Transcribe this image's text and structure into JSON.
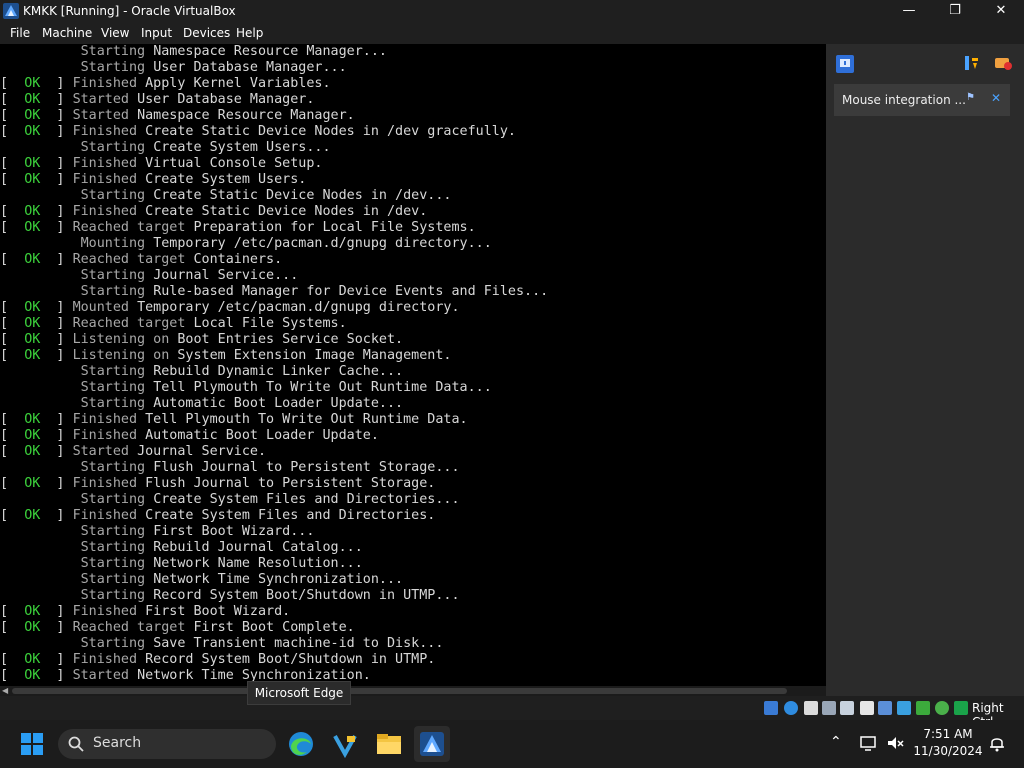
{
  "window": {
    "title": "KMKK [Running] - Oracle VirtualBox"
  },
  "menu": [
    "File",
    "Machine",
    "View",
    "Input",
    "Devices",
    "Help"
  ],
  "console_lines": [
    {
      "ok": false,
      "verb": "Starting",
      "rest": "Namespace Resource Manager..."
    },
    {
      "ok": false,
      "verb": "Starting",
      "rest": "User Database Manager..."
    },
    {
      "ok": true,
      "verb": "Finished",
      "rest": "Apply Kernel Variables."
    },
    {
      "ok": true,
      "verb": "Started",
      "rest": "User Database Manager."
    },
    {
      "ok": true,
      "verb": "Started",
      "rest": "Namespace Resource Manager."
    },
    {
      "ok": true,
      "verb": "Finished",
      "rest": "Create Static Device Nodes in /dev gracefully."
    },
    {
      "ok": false,
      "verb": "Starting",
      "rest": "Create System Users..."
    },
    {
      "ok": true,
      "verb": "Finished",
      "rest": "Virtual Console Setup."
    },
    {
      "ok": true,
      "verb": "Finished",
      "rest": "Create System Users."
    },
    {
      "ok": false,
      "verb": "Starting",
      "rest": "Create Static Device Nodes in /dev..."
    },
    {
      "ok": true,
      "verb": "Finished",
      "rest": "Create Static Device Nodes in /dev."
    },
    {
      "ok": true,
      "verb": "Reached target",
      "rest": "Preparation for Local File Systems."
    },
    {
      "ok": false,
      "verb": "Mounting",
      "rest": "Temporary /etc/pacman.d/gnupg directory..."
    },
    {
      "ok": true,
      "verb": "Reached target",
      "rest": "Containers."
    },
    {
      "ok": false,
      "verb": "Starting",
      "rest": "Journal Service..."
    },
    {
      "ok": false,
      "verb": "Starting",
      "rest": "Rule-based Manager for Device Events and Files..."
    },
    {
      "ok": true,
      "verb": "Mounted",
      "rest": "Temporary /etc/pacman.d/gnupg directory."
    },
    {
      "ok": true,
      "verb": "Reached target",
      "rest": "Local File Systems."
    },
    {
      "ok": true,
      "verb": "Listening on",
      "rest": "Boot Entries Service Socket."
    },
    {
      "ok": true,
      "verb": "Listening on",
      "rest": "System Extension Image Management."
    },
    {
      "ok": false,
      "verb": "Starting",
      "rest": "Rebuild Dynamic Linker Cache..."
    },
    {
      "ok": false,
      "verb": "Starting",
      "rest": "Tell Plymouth To Write Out Runtime Data..."
    },
    {
      "ok": false,
      "verb": "Starting",
      "rest": "Automatic Boot Loader Update..."
    },
    {
      "ok": true,
      "verb": "Finished",
      "rest": "Tell Plymouth To Write Out Runtime Data."
    },
    {
      "ok": true,
      "verb": "Finished",
      "rest": "Automatic Boot Loader Update."
    },
    {
      "ok": true,
      "verb": "Started",
      "rest": "Journal Service."
    },
    {
      "ok": false,
      "verb": "Starting",
      "rest": "Flush Journal to Persistent Storage..."
    },
    {
      "ok": true,
      "verb": "Finished",
      "rest": "Flush Journal to Persistent Storage."
    },
    {
      "ok": false,
      "verb": "Starting",
      "rest": "Create System Files and Directories..."
    },
    {
      "ok": true,
      "verb": "Finished",
      "rest": "Create System Files and Directories."
    },
    {
      "ok": false,
      "verb": "Starting",
      "rest": "First Boot Wizard..."
    },
    {
      "ok": false,
      "verb": "Starting",
      "rest": "Rebuild Journal Catalog..."
    },
    {
      "ok": false,
      "verb": "Starting",
      "rest": "Network Name Resolution..."
    },
    {
      "ok": false,
      "verb": "Starting",
      "rest": "Network Time Synchronization..."
    },
    {
      "ok": false,
      "verb": "Starting",
      "rest": "Record System Boot/Shutdown in UTMP..."
    },
    {
      "ok": true,
      "verb": "Finished",
      "rest": "First Boot Wizard."
    },
    {
      "ok": true,
      "verb": "Reached target",
      "rest": "First Boot Complete."
    },
    {
      "ok": false,
      "verb": "Starting",
      "rest": "Save Transient machine-id to Disk..."
    },
    {
      "ok": true,
      "verb": "Finished",
      "rest": "Record System Boot/Shutdown in UTMP."
    },
    {
      "ok": true,
      "verb": "Started",
      "rest": "Network Time Synchronization."
    }
  ],
  "ok_text": "OK",
  "notification": {
    "label": "Mouse integration ..."
  },
  "statusbar": {
    "host_key": "Right Ctrl"
  },
  "tooltip": "Microsoft Edge",
  "taskbar": {
    "search_placeholder": "Search",
    "time": "7:51 AM",
    "date": "11/30/2024"
  },
  "colors": {
    "ok_green": "#3cd23c",
    "console_bg": "#000000",
    "chrome_bg": "#1f1f1f"
  }
}
